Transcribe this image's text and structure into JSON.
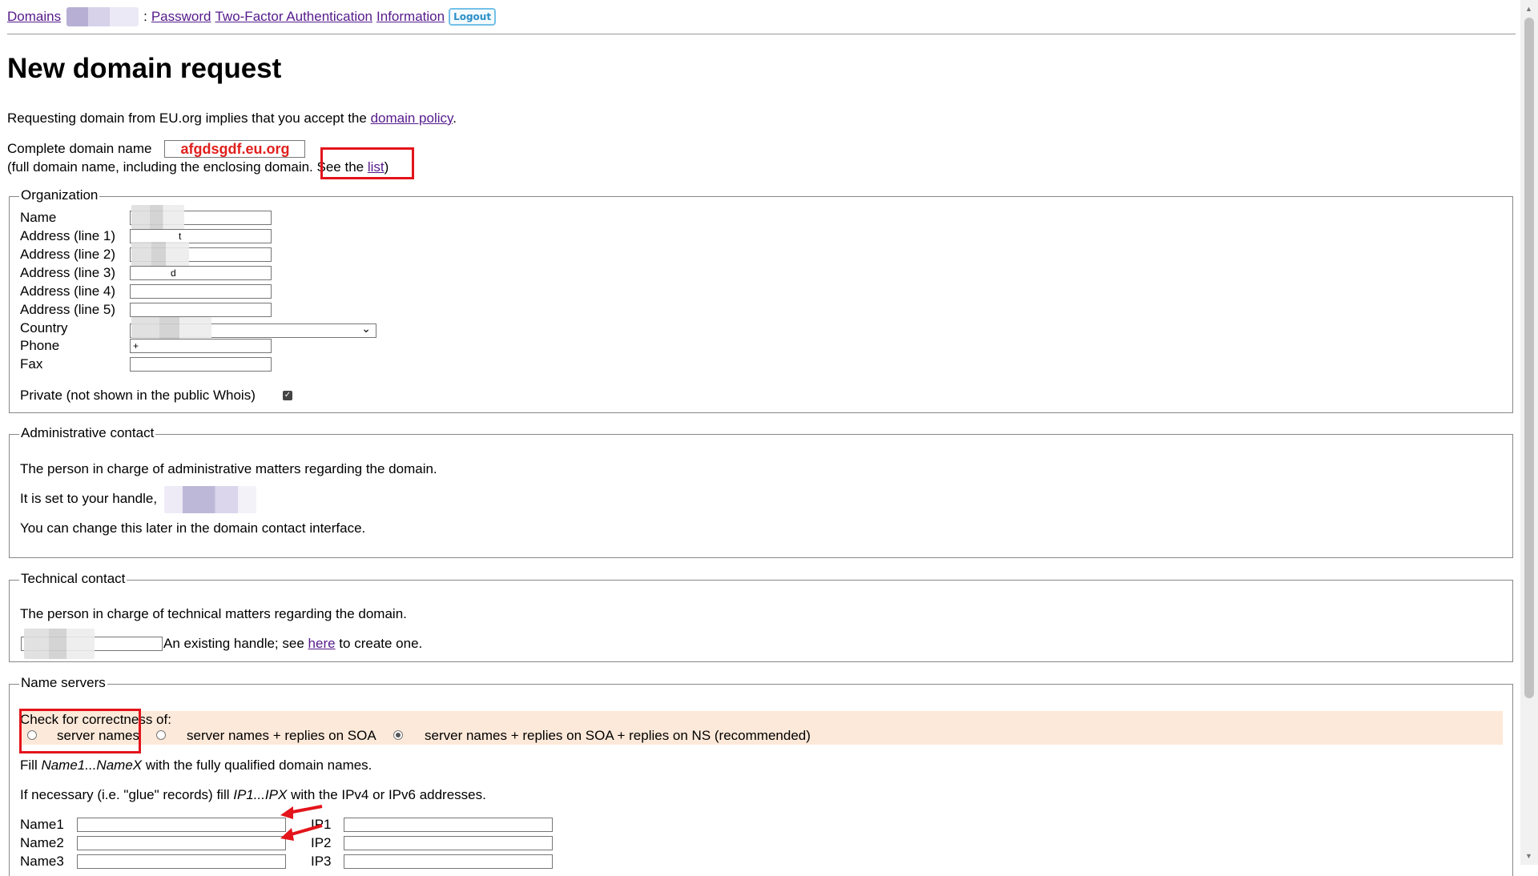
{
  "nav": {
    "domains": "Domains",
    "separator": ":",
    "password": "Password",
    "two_factor": "Two-Factor Authentication",
    "information": "Information",
    "logout": "Logout"
  },
  "title": "New domain request",
  "intro": {
    "prefix": "Requesting domain from EU.org implies that you accept the",
    "policy_link": "domain policy",
    "suffix": "."
  },
  "domain_name": {
    "label": "Complete domain name",
    "value": "afgdsgdf.eu.org",
    "note": "(full domain name, including the enclosing domain.",
    "see_the": "See the",
    "list_link": "list",
    "close": ")"
  },
  "organization": {
    "legend": "Organization",
    "fields": [
      {
        "label": "Name"
      },
      {
        "label": "Address (line 1)",
        "value": "t"
      },
      {
        "label": "Address (line 2)"
      },
      {
        "label": "Address (line 3)",
        "value": "d"
      },
      {
        "label": "Address (line 4)"
      },
      {
        "label": "Address (line 5)"
      }
    ],
    "country_label": "Country",
    "phone_label": "Phone",
    "phone_value": "+",
    "fax_label": "Fax",
    "private_label": "Private (not shown in the public Whois)",
    "private_checked": true
  },
  "admin_contact": {
    "legend": "Administrative contact",
    "line1": "The person in charge of administrative matters regarding the domain.",
    "line2": "It is set to your handle,",
    "line3": "You can change this later in the domain contact interface."
  },
  "tech_contact": {
    "legend": "Technical contact",
    "line1": "The person in charge of technical matters regarding the domain.",
    "handle_note": "An existing handle; see",
    "here_link": "here",
    "handle_suffix": "to create one."
  },
  "name_servers": {
    "legend": "Name servers",
    "check_label": "Check for correctness of:",
    "options": [
      {
        "label": "server names",
        "selected": false
      },
      {
        "label": "server names + replies on SOA",
        "selected": false
      },
      {
        "label": "server names + replies on SOA + replies on NS (recommended)",
        "selected": true
      }
    ],
    "fill_prefix": "Fill",
    "fill_names": "Name1...NameX",
    "fill_suffix": "with the fully qualified domain names.",
    "glue_prefix": "If necessary (i.e. \"glue\" records) fill",
    "glue_ips": "IP1...IPX",
    "glue_suffix": "with the IPv4 or IPv6 addresses.",
    "rows": [
      {
        "name_label": "Name1",
        "ip_label": "IP1"
      },
      {
        "name_label": "Name2",
        "ip_label": "IP2"
      },
      {
        "name_label": "Name3",
        "ip_label": "IP3"
      }
    ]
  },
  "colors": {
    "annotation_red": "#e3141b",
    "link": "#551a8b",
    "ns_band": "#fde9d9"
  }
}
